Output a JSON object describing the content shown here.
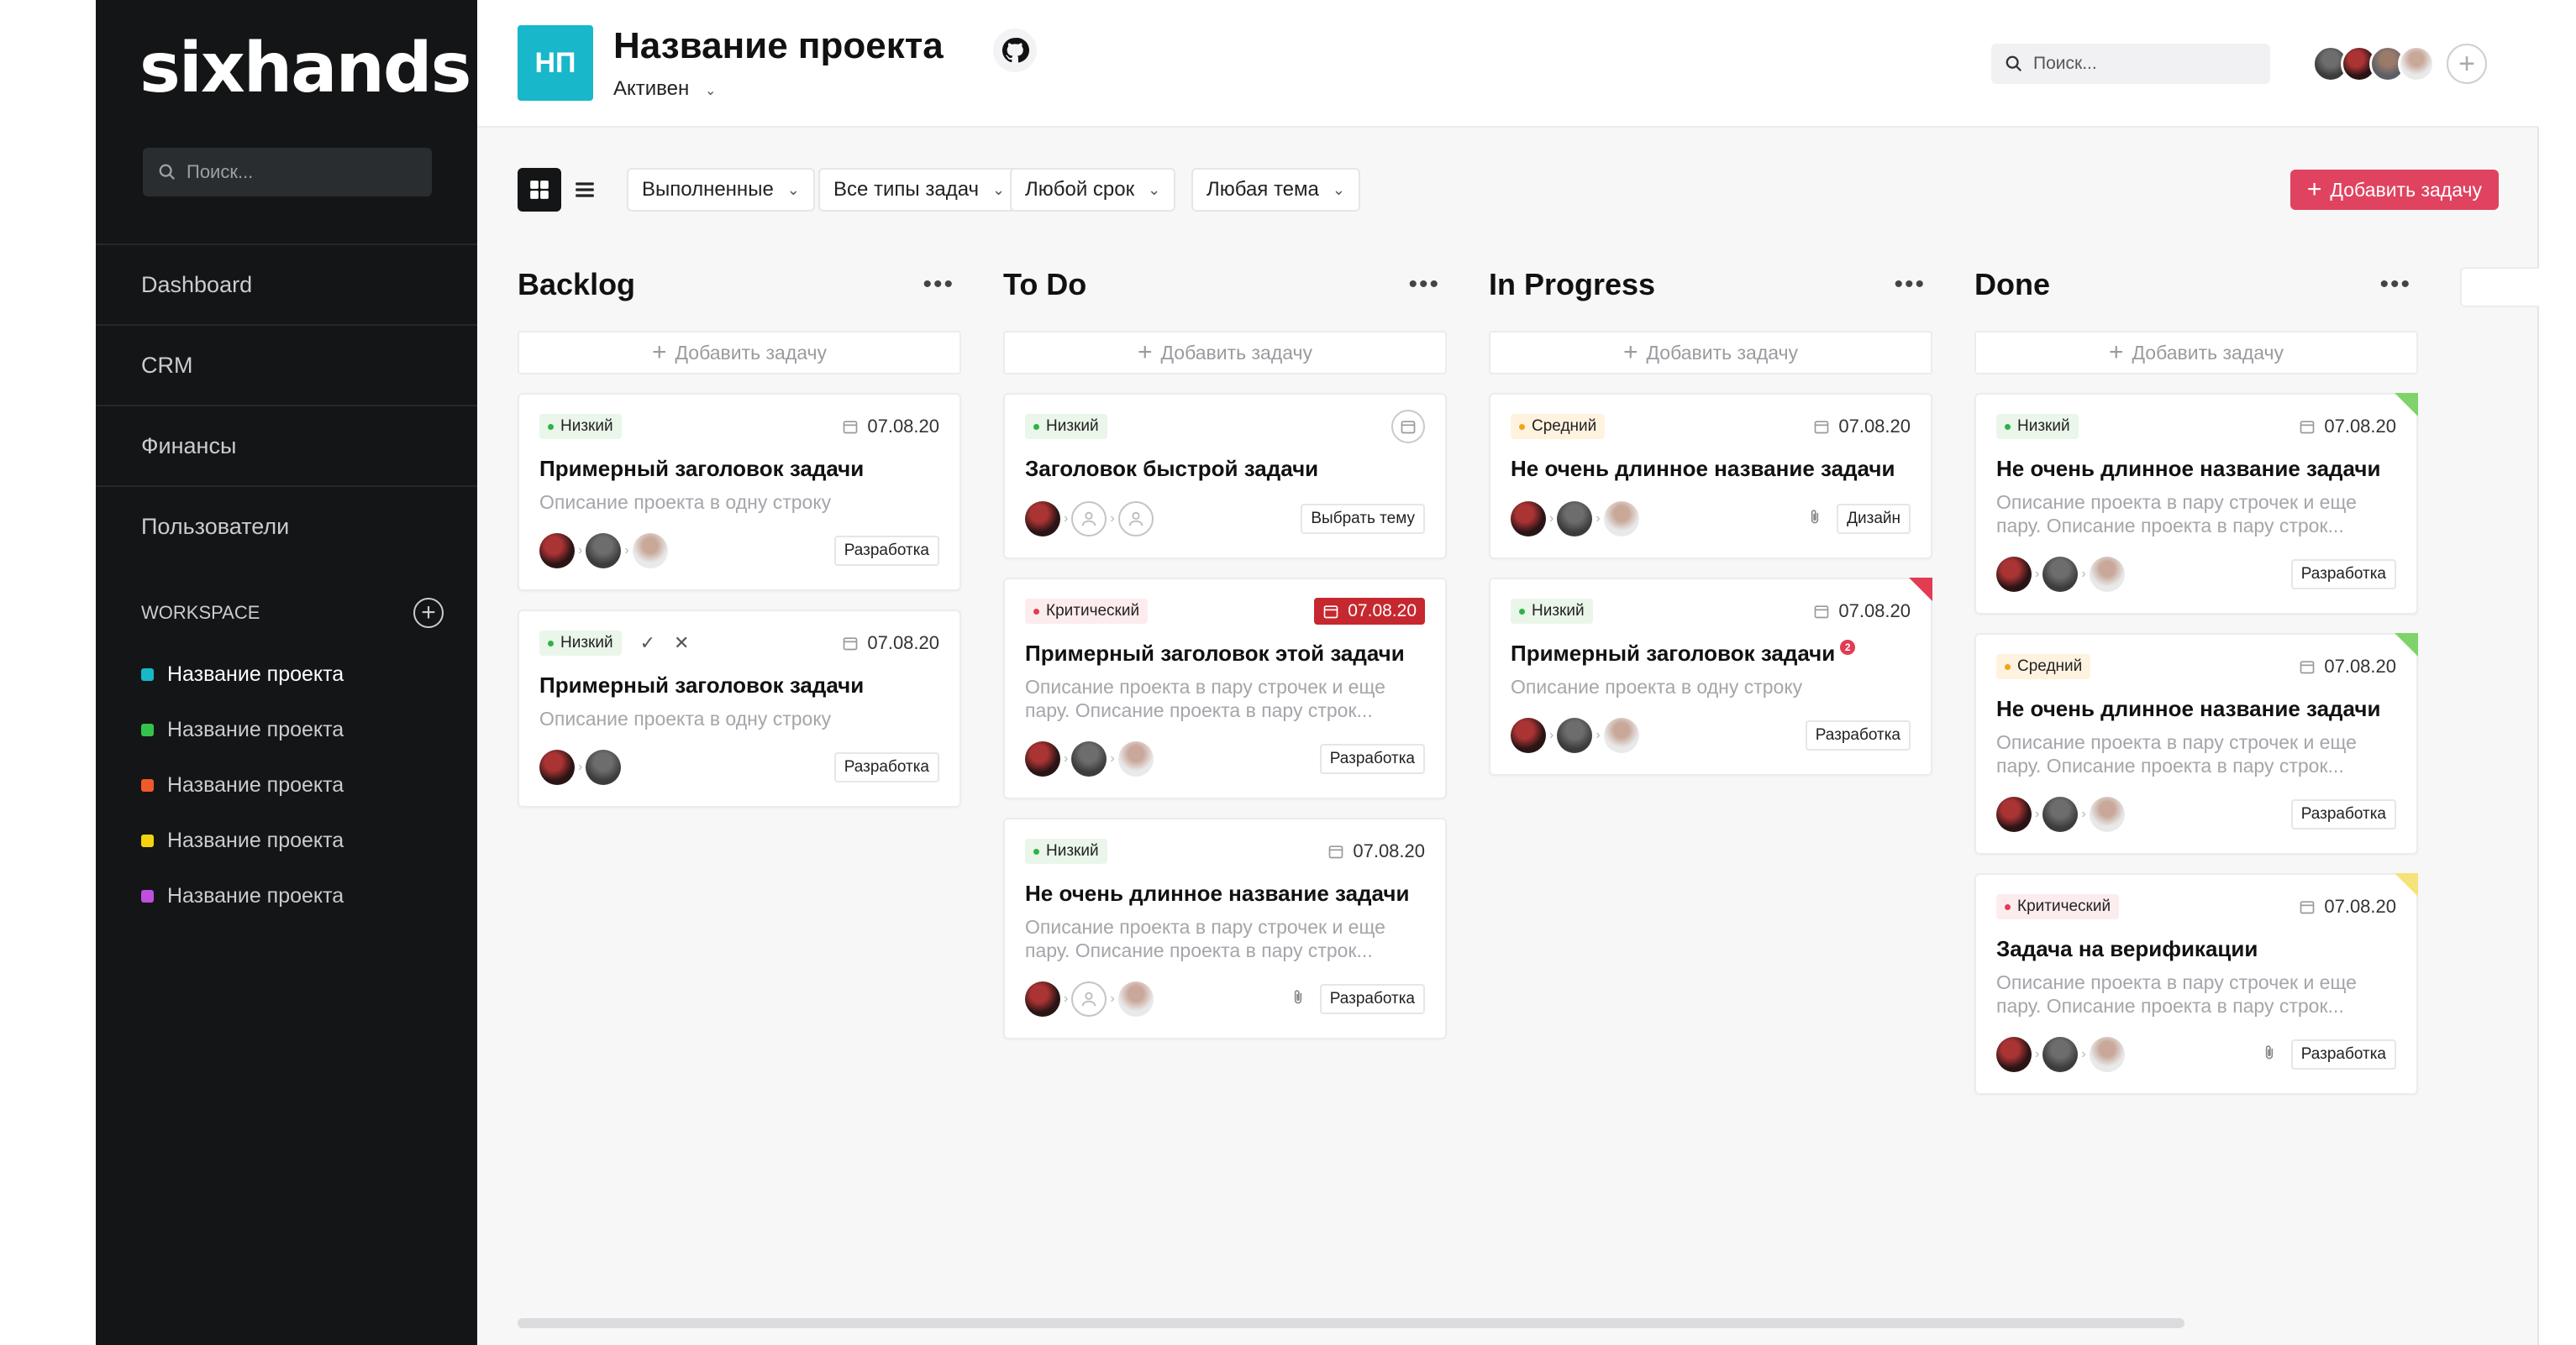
{
  "sidebar": {
    "logo": "sixhands",
    "search_placeholder": "Поиск...",
    "nav": [
      "Dashboard",
      "CRM",
      "Финансы",
      "Пользователи"
    ],
    "workspace_label": "WORKSPACE",
    "projects": [
      {
        "name": "Название проекта",
        "color": "#18b7c9",
        "active": true
      },
      {
        "name": "Название проекта",
        "color": "#35c24a",
        "active": false
      },
      {
        "name": "Название проекта",
        "color": "#f0592b",
        "active": false
      },
      {
        "name": "Название проекта",
        "color": "#f5d20f",
        "active": false
      },
      {
        "name": "Название проекта",
        "color": "#c04fe0",
        "active": false
      }
    ]
  },
  "header": {
    "badge": "НП",
    "title": "Название проекта",
    "status": "Активен",
    "search_placeholder": "Поиск...",
    "accent_color": "#18b7c9"
  },
  "toolbar": {
    "filters": [
      "Выполненные",
      "Все типы задач",
      "Любой срок",
      "Любая тема"
    ],
    "add_task": "Добавить задачу",
    "add_task_color": "#e0435f"
  },
  "board": {
    "add_in_column": "Добавить задачу",
    "columns": [
      {
        "title": "Backlog",
        "cards": [
          {
            "priority": "Низкий",
            "date": "07.08.20",
            "title": "Примерный заголовок задачи",
            "desc": "Описание проекта в одну строку",
            "tag": "Разработка"
          },
          {
            "priority": "Низкий",
            "date": "07.08.20",
            "title": "Примерный заголовок задачи",
            "desc": "Описание проекта в одну строку",
            "tag": "Разработка"
          }
        ]
      },
      {
        "title": "To Do",
        "cards": [
          {
            "priority": "Низкий",
            "title": "Заголовок быстрой задачи",
            "tag": "Выбрать тему"
          },
          {
            "priority": "Критический",
            "date": "07.08.20",
            "title": "Примерный заголовок этой задачи",
            "desc": "Описание проекта в пару строчек и еще пару. Описание проекта в пару строк...",
            "tag": "Разработка"
          },
          {
            "priority": "Низкий",
            "date": "07.08.20",
            "title": "Не очень длинное название задачи",
            "desc": "Описание проекта в пару строчек и еще пару. Описание проекта в пару строк...",
            "tag": "Разработка"
          }
        ]
      },
      {
        "title": "In Progress",
        "cards": [
          {
            "priority": "Средний",
            "date": "07.08.20",
            "title": "Не очень длинное название задачи",
            "tag": "Дизайн"
          },
          {
            "priority": "Низкий",
            "date": "07.08.20",
            "title": "Примерный заголовок задачи",
            "badge": "2",
            "desc": "Описание проекта в одну строку",
            "tag": "Разработка"
          }
        ]
      },
      {
        "title": "Done",
        "cards": [
          {
            "priority": "Низкий",
            "date": "07.08.20",
            "title": "Не очень длинное название задачи",
            "desc": "Описание проекта в пару строчек и еще пару. Описание проекта в пару строк...",
            "tag": "Разработка"
          },
          {
            "priority": "Средний",
            "date": "07.08.20",
            "title": "Не очень длинное название задачи",
            "desc": "Описание проекта в пару строчек и еще пару. Описание проекта в пару строк...",
            "tag": "Разработка"
          },
          {
            "priority": "Критический",
            "date": "07.08.20",
            "title": "Задача на верификации",
            "desc": "Описание проекта в пару строчек и еще пару. Описание проекта в пару строк...",
            "tag": "Разработка"
          }
        ]
      }
    ]
  }
}
